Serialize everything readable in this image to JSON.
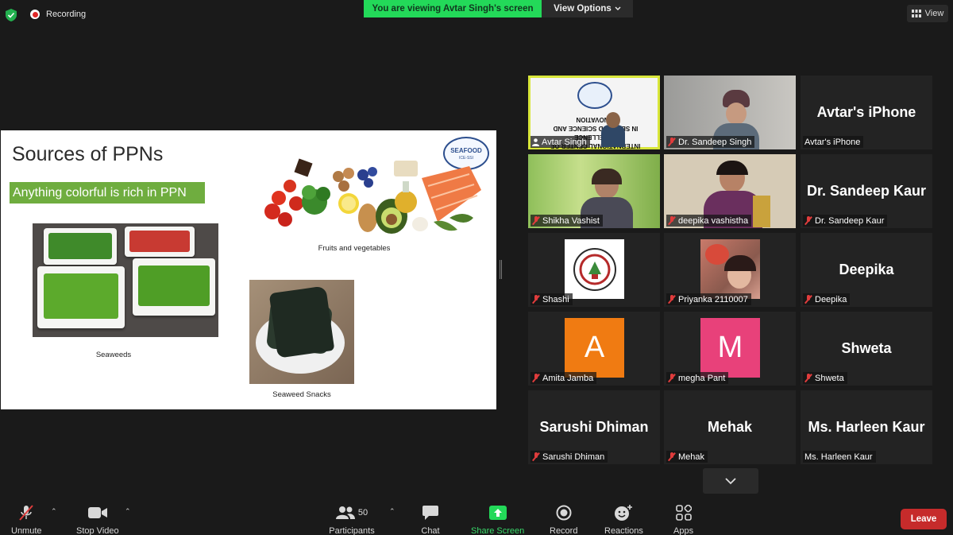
{
  "topbar": {
    "recording_label": "Recording",
    "viewing_banner": "You are viewing Avtar Singh's screen",
    "view_options": "View Options",
    "view_label": "View"
  },
  "slide": {
    "title": "Sources of PPNs",
    "highlight": "Anything colorful is rich in PPN",
    "logo_text": "SEAFOOD",
    "logo_sub": "ICE-SSI",
    "captions": {
      "fruits": "Fruits and vegetables",
      "seaweeds": "Seaweeds",
      "snacks": "Seaweed Snacks"
    }
  },
  "participants": [
    {
      "name": "Avtar Singh",
      "big": "",
      "muted": false,
      "active": true,
      "type": "video-slide"
    },
    {
      "name": "Dr. Sandeep Singh",
      "big": "",
      "muted": true,
      "type": "video-man"
    },
    {
      "name": "Avtar's iPhone",
      "big": "Avtar's iPhone",
      "muted": false,
      "type": "name"
    },
    {
      "name": "Shikha Vashist",
      "big": "",
      "muted": true,
      "type": "video-grass"
    },
    {
      "name": "deepika vashistha",
      "big": "",
      "muted": true,
      "type": "video-woman"
    },
    {
      "name": "Dr. Sandeep Kaur",
      "big": "Dr. Sandeep Kaur",
      "muted": true,
      "type": "name"
    },
    {
      "name": "Shashi",
      "big": "",
      "muted": true,
      "type": "emblem"
    },
    {
      "name": "Priyanka 2110007",
      "big": "",
      "muted": true,
      "type": "photo"
    },
    {
      "name": "Deepika",
      "big": "Deepika",
      "muted": true,
      "type": "name"
    },
    {
      "name": "Amita Jamba",
      "big": "",
      "muted": true,
      "type": "letter",
      "letter": "A",
      "color": "#f07b12"
    },
    {
      "name": "megha Pant",
      "big": "",
      "muted": true,
      "type": "letter",
      "letter": "M",
      "color": "#e8417a"
    },
    {
      "name": "Shweta",
      "big": "Shweta",
      "muted": true,
      "type": "name"
    },
    {
      "name": "Sarushi Dhiman",
      "big": "Sarushi Dhiman",
      "muted": true,
      "type": "name"
    },
    {
      "name": "Mehak",
      "big": "Mehak",
      "muted": true,
      "type": "name"
    },
    {
      "name": "Ms. Harleen Kaur",
      "big": "Ms. Harleen Kaur",
      "muted": false,
      "type": "name"
    }
  ],
  "toolbar": {
    "unmute": "Unmute",
    "stop_video": "Stop Video",
    "participants": "Participants",
    "participant_count": "50",
    "chat": "Chat",
    "share_screen": "Share Screen",
    "record": "Record",
    "reactions": "Reactions",
    "apps": "Apps",
    "leave": "Leave"
  },
  "colors": {
    "share_green": "#39d96a",
    "banner_green": "#23d959",
    "leave_red": "#c62b2b",
    "active_border": "#d8e63a"
  }
}
